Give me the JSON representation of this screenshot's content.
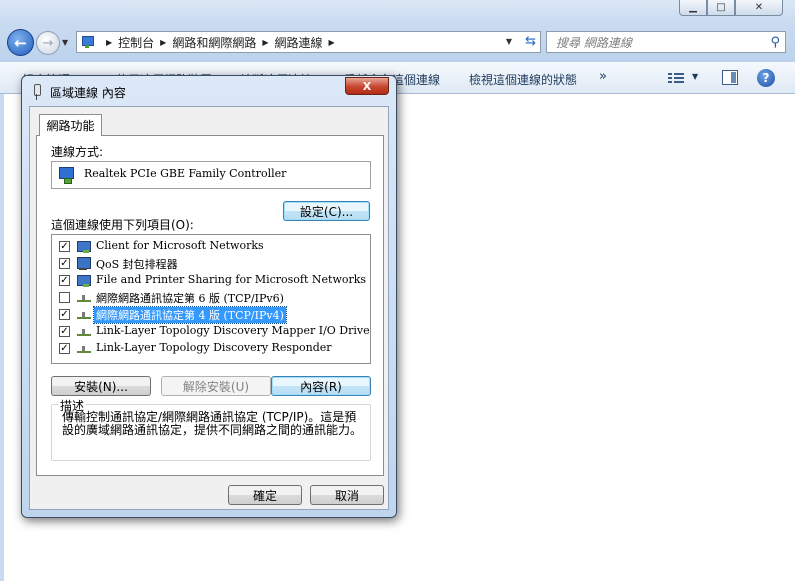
{
  "explorer": {
    "address": {
      "crumbs": [
        "控制台",
        "網路和網際網路",
        "網路連線"
      ]
    },
    "search": {
      "placeholder": "搜尋 網路連線"
    },
    "commands": [
      "組合管理",
      "停用這個網路裝置",
      "診斷這個連線",
      "重新命名這個連線",
      "檢視這個連線的狀態"
    ]
  },
  "dialog": {
    "title": "區域連線 內容",
    "close_label": "X",
    "tab_label": "網路功能",
    "connect_using_label": "連線方式:",
    "adapter_name": "Realtek PCIe GBE Family Controller",
    "configure_button": "設定(C)...",
    "items_label": "這個連線使用下列項目(O):",
    "items": [
      {
        "label": "Client for Microsoft Networks",
        "checked": true,
        "icon": "network-client-icon",
        "selected": false
      },
      {
        "label": "QoS 封包排程器",
        "checked": true,
        "icon": "qos-scheduler-icon",
        "selected": false
      },
      {
        "label": "File and Printer Sharing for Microsoft Networks",
        "checked": true,
        "icon": "file-sharing-icon",
        "selected": false
      },
      {
        "label": "網際網路通訊協定第 6 版 (TCP/IPv6)",
        "checked": false,
        "icon": "protocol-icon",
        "selected": false
      },
      {
        "label": "網際網路通訊協定第 4 版 (TCP/IPv4)",
        "checked": true,
        "icon": "protocol-icon",
        "selected": true
      },
      {
        "label": "Link-Layer Topology Discovery Mapper I/O Driver",
        "checked": true,
        "icon": "protocol-icon",
        "selected": false
      },
      {
        "label": "Link-Layer Topology Discovery Responder",
        "checked": true,
        "icon": "protocol-icon",
        "selected": false
      }
    ],
    "install_button": "安裝(N)...",
    "uninstall_button": "解除安裝(U)",
    "properties_button": "內容(R)",
    "description_legend": "描述",
    "description_text": "傳輸控制通訊協定/網際網路通訊協定 (TCP/IP)。這是預設的廣域網路通訊協定，提供不同網路之間的通訊能力。",
    "ok_button": "確定",
    "cancel_button": "取消"
  }
}
